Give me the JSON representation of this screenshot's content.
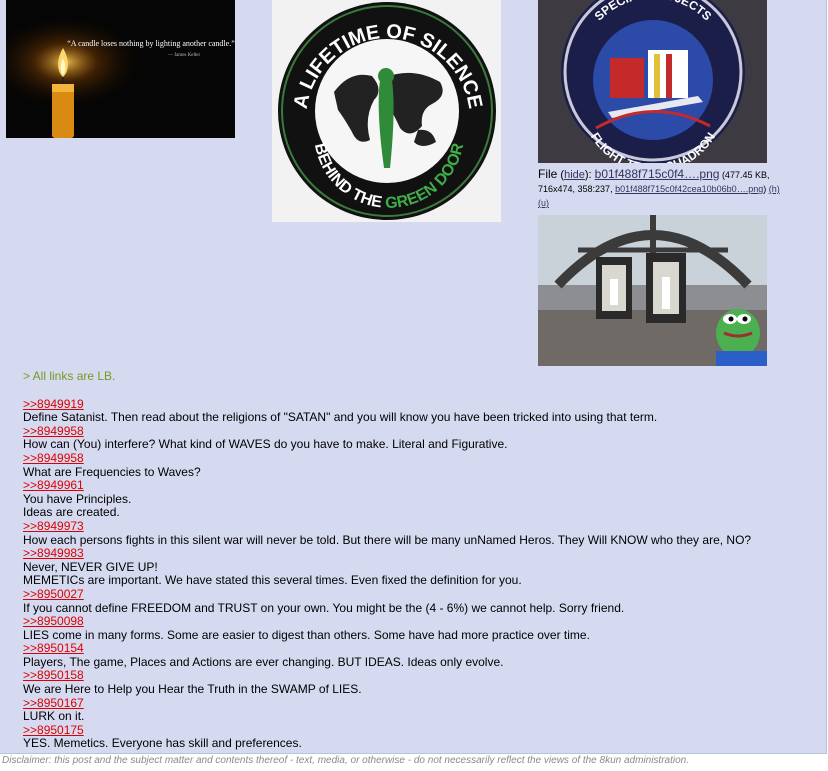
{
  "images": {
    "candle": {
      "quote": "“A candle loses nothing by lighting another candle.”",
      "author": "— James Keller"
    },
    "patch_silence": {
      "top_text": "A LIFETIME OF SILENCE",
      "bottom_text_a": "BEHIND THE",
      "bottom_text_b": "GREEN DOOR"
    },
    "patch_special": {
      "top_text": "SPECIAL PROJECTS",
      "bottom_text": "FLIGHT TEST SQUADRON"
    },
    "lanterns": {}
  },
  "file_info": {
    "label": "File",
    "open_paren": " (",
    "hide": "hide",
    "close_colon": "): ",
    "filename": "b01f488f715c0f4….png",
    "details": " (477.45 KB, 716x474, 358:237, ",
    "full_filename": "b01f488f715c0f42cea10b06b0….png",
    "sep": ") ",
    "h": "(h)",
    "u": "(u)"
  },
  "post": {
    "lines": [
      {
        "type": "quote",
        "text": "> All links are LB."
      },
      {
        "type": "blank"
      },
      {
        "type": "link",
        "text": ">>8949919"
      },
      {
        "type": "text",
        "text": "Define Satanist. Then read about the religions of \"SATAN\" and you will know you have been tricked into using that term."
      },
      {
        "type": "link",
        "text": ">>8949958"
      },
      {
        "type": "text",
        "text": "How can (You) interfere? What kind of WAVES do you have to make. Literal and Figurative."
      },
      {
        "type": "link",
        "text": ">>8949958"
      },
      {
        "type": "text",
        "text": "What are Frequencies to Waves?"
      },
      {
        "type": "link",
        "text": ">>8949961"
      },
      {
        "type": "text",
        "text": "You have Principles."
      },
      {
        "type": "text",
        "text": "Ideas are created."
      },
      {
        "type": "link",
        "text": ">>8949973"
      },
      {
        "type": "text",
        "text": "How each persons fights in this silent war will never be told. But there will be many unNamed Heros. They Will KNOW who they are, NO?"
      },
      {
        "type": "link",
        "text": ">>8949983"
      },
      {
        "type": "text",
        "text": "Never, NEVER GIVE UP!"
      },
      {
        "type": "text",
        "text": "MEMETICs are important. We have stated this several times. Even fixed the definition for you."
      },
      {
        "type": "link",
        "text": ">>8950027"
      },
      {
        "type": "text",
        "text": "If you cannot define FREEDOM and TRUST on your own. You might be the (4 - 6%) we cannot help. Sorry friend."
      },
      {
        "type": "link",
        "text": ">>8950098"
      },
      {
        "type": "text",
        "text": "LIES come in many forms. Some are easier to digest than others. Some have had more practice over time."
      },
      {
        "type": "link",
        "text": ">>8950154"
      },
      {
        "type": "text",
        "text": "Players, The game, Places and Actions are ever changing. BUT IDEAS. Ideas only evolve."
      },
      {
        "type": "link",
        "text": ">>8950158"
      },
      {
        "type": "text",
        "text": "We are Here to Help you Hear the Truth in the SWAMP of LIES."
      },
      {
        "type": "link",
        "text": ">>8950167"
      },
      {
        "type": "text",
        "text": "LURK on it."
      },
      {
        "type": "link",
        "text": ">>8950175"
      },
      {
        "type": "text",
        "text": "YES. Memetics. Everyone has skill and preferences."
      }
    ]
  },
  "disclaimer": "Disclaimer: this post and the subject matter and contents thereof - text, media, or otherwise - do not necessarily reflect the views of the 8kun administration.",
  "colors": {
    "post_bg": "#d6daf0",
    "reply_link": "#dd0000",
    "greentext": "#789922",
    "file_link": "#34345c"
  }
}
